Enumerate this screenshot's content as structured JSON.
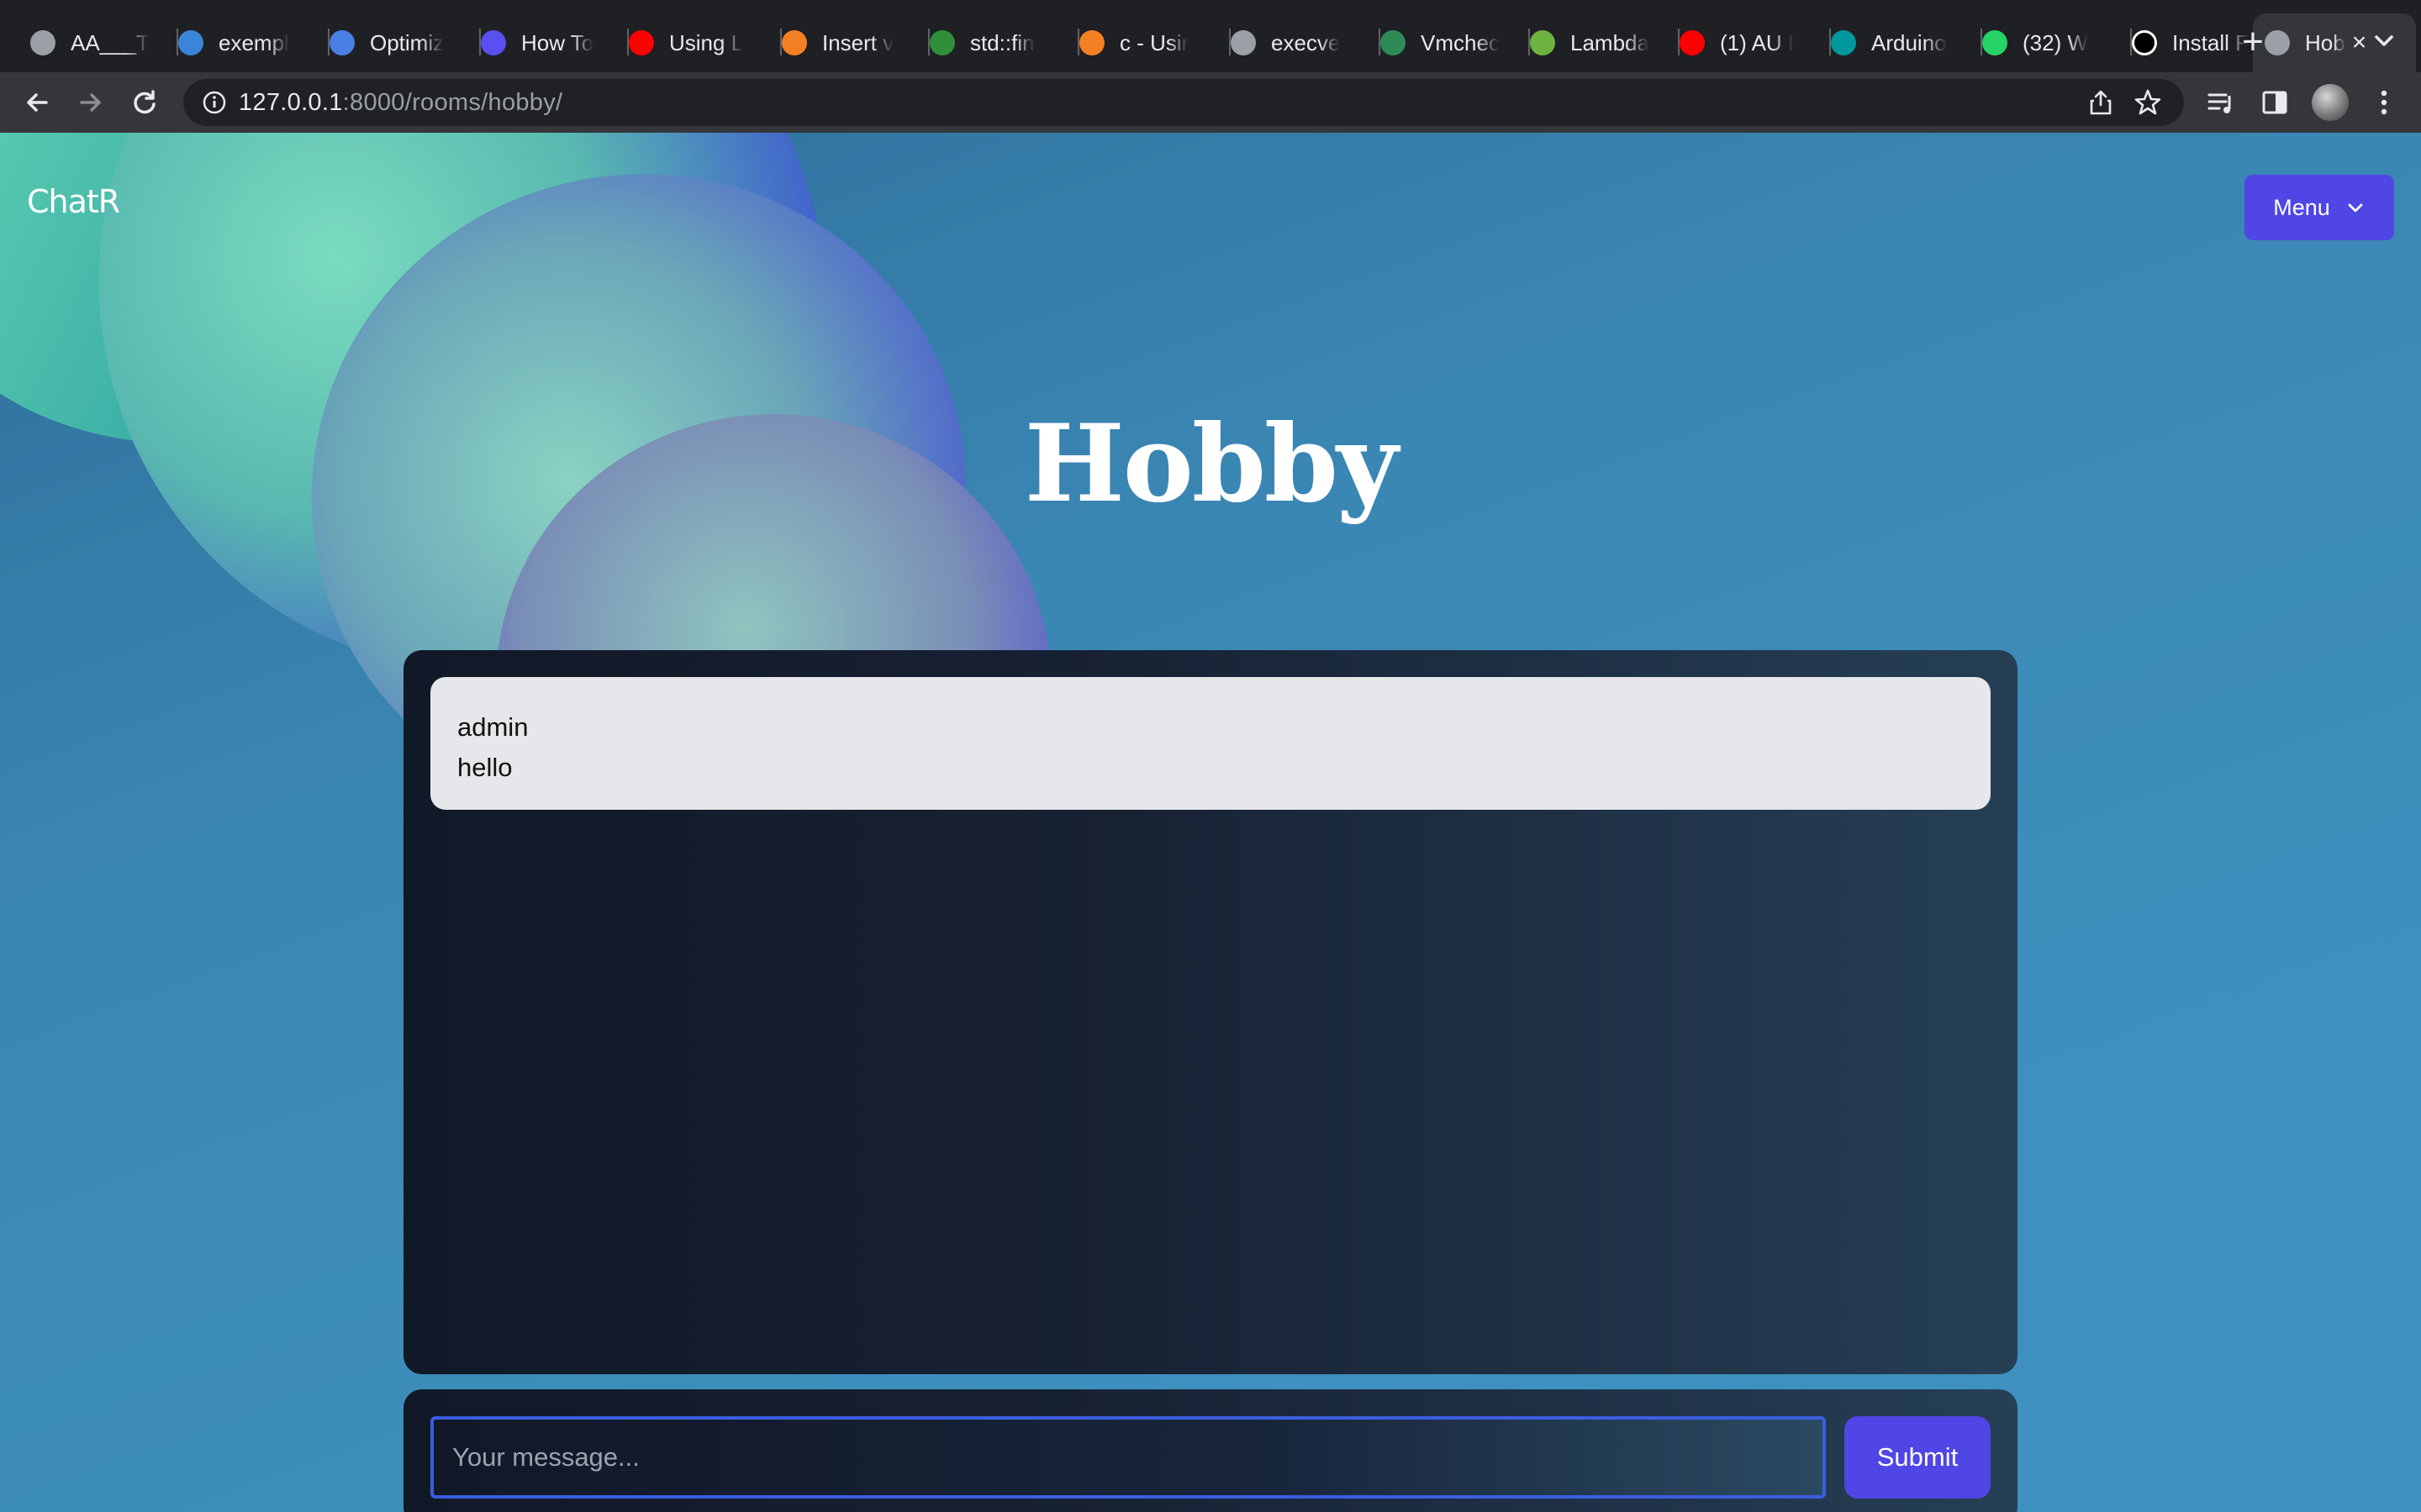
{
  "browser": {
    "tabs": [
      {
        "label": "AA___T",
        "icon": "globe-icon",
        "color": "#9aa0a6"
      },
      {
        "label": "exempl",
        "icon": "ibb-icon",
        "color": "#3a84d9"
      },
      {
        "label": "Optimiz",
        "icon": "optimize-icon",
        "color": "#4a7fe6"
      },
      {
        "label": "How To",
        "icon": "u-logo-icon",
        "color": "#5a4ff0"
      },
      {
        "label": "Using L",
        "icon": "youtube-icon",
        "color": "#ff0000"
      },
      {
        "label": "Insert v",
        "icon": "stackoverflow-icon",
        "color": "#f48024"
      },
      {
        "label": "std::fin",
        "icon": "cplusplus-icon",
        "color": "#2f8f3a"
      },
      {
        "label": "c - Usir",
        "icon": "stackoverflow-icon",
        "color": "#f48024"
      },
      {
        "label": "execve",
        "icon": "globe-icon",
        "color": "#9aa0a6"
      },
      {
        "label": "Vmchec",
        "icon": "check-icon",
        "color": "#2e8b57"
      },
      {
        "label": "Lambda",
        "icon": "leaf-icon",
        "color": "#6db33f"
      },
      {
        "label": "(1) AU I",
        "icon": "youtube-icon",
        "color": "#ff0000"
      },
      {
        "label": "Arduino",
        "icon": "arduino-icon",
        "color": "#00979d"
      },
      {
        "label": "(32) W",
        "icon": "whatsapp-icon",
        "color": "#25d366"
      },
      {
        "label": "Install F",
        "icon": "medium-icon",
        "color": "#ffffff"
      },
      {
        "label": "Hob",
        "icon": "globe-icon",
        "color": "#9aa0a6",
        "active": true
      }
    ],
    "url": {
      "host": "127.0.0.1",
      "rest": ":8000/rooms/hobby/"
    }
  },
  "page": {
    "brand": "ChatR",
    "menu_label": "Menu",
    "room_title": "Hobby",
    "messages": [
      {
        "author": "admin",
        "text": "hello"
      }
    ],
    "composer": {
      "placeholder": "Your message...",
      "submit_label": "Submit"
    }
  },
  "colors": {
    "accent": "#4f46e5",
    "message_bg": "#e5e7eb",
    "input_border": "#3b5ee0"
  }
}
